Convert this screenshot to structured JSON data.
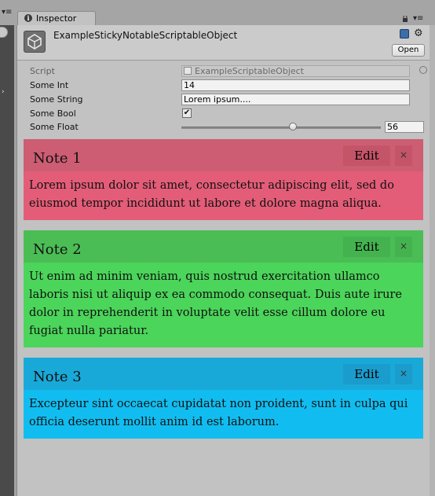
{
  "tab": {
    "label": "Inspector"
  },
  "header": {
    "title": "ExampleStickyNotableScriptableObject",
    "open_label": "Open"
  },
  "fields": {
    "script": {
      "label": "Script",
      "value": "ExampleScriptableObject"
    },
    "some_int": {
      "label": "Some Int",
      "value": "14"
    },
    "some_string": {
      "label": "Some String",
      "value": "Lorem ipsum...."
    },
    "some_bool": {
      "label": "Some Bool",
      "checked": true,
      "check_glyph": "✔"
    },
    "some_float": {
      "label": "Some Float",
      "value": "56",
      "fraction": 0.56
    }
  },
  "notes": [
    {
      "title": "Note 1",
      "edit_label": "Edit",
      "close_label": "×",
      "body": "Lorem ipsum dolor sit amet, consectetur adipiscing elit, sed do eiusmod tempor incididunt ut labore et dolore magna aliqua.",
      "head_color": "#cd5d73",
      "body_color": "#e35d78",
      "button_color": "#c45468"
    },
    {
      "title": "Note 2",
      "edit_label": "Edit",
      "close_label": "×",
      "body": "Ut enim ad minim veniam, quis nostrud exercitation ullamco laboris nisi ut aliquip ex ea commodo consequat. Duis aute irure dolor in reprehenderit in voluptate velit esse cillum dolore eu fugiat nulla pariatur.",
      "head_color": "#4bbd55",
      "body_color": "#4bd55a",
      "button_color": "#44b34f"
    },
    {
      "title": "Note 3",
      "edit_label": "Edit",
      "close_label": "×",
      "body": "Excepteur sint occaecat cupidatat non proident, sunt in culpa qui officia deserunt mollit anim id est laborum.",
      "head_color": "#19a9d9",
      "body_color": "#11bdf0",
      "button_color": "#1a9ccc"
    }
  ]
}
